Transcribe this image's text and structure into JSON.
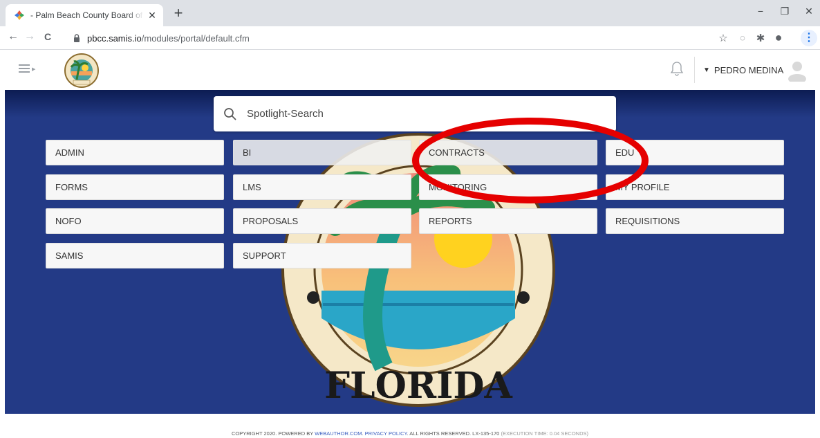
{
  "browser": {
    "tab_title": "- Palm Beach County Board of Co",
    "url_host": "pbcc.samis.io",
    "url_path": "/modules/portal/default.cfm",
    "window_min": "−",
    "window_restore": "❐",
    "window_close": "✕",
    "new_tab": "+",
    "tab_close": "✕",
    "back": "←",
    "forward": "→",
    "reload": "C"
  },
  "header": {
    "user_name": "PEDRO MEDINA",
    "user_chevron": "▼"
  },
  "search": {
    "placeholder": "Spotlight-Search"
  },
  "modules": [
    {
      "label": "ADMIN"
    },
    {
      "label": "BI"
    },
    {
      "label": "CONTRACTS"
    },
    {
      "label": "EDU"
    },
    {
      "label": "FORMS"
    },
    {
      "label": "LMS"
    },
    {
      "label": "MONITORING"
    },
    {
      "label": "MY PROFILE"
    },
    {
      "label": "NOFO"
    },
    {
      "label": "PROPOSALS"
    },
    {
      "label": "REPORTS"
    },
    {
      "label": "REQUISITIONS"
    },
    {
      "label": "SAMIS"
    },
    {
      "label": "SUPPORT"
    }
  ],
  "footer": {
    "prefix": "COPYRIGHT 2020. POWERED BY ",
    "powered_by_link": "WEBAUTHOR.COM",
    "separator": ". ",
    "privacy_link": "PRIVACY POLICY",
    "rights": ". ALL RIGHTS RESERVED. LX-135-170 ",
    "execution": "(EXECUTION TIME: 0.04 SECONDS)"
  },
  "seal": {
    "text_bottom": "FLORIDA"
  },
  "colors": {
    "main_bg": "#233a86",
    "highlight": "#e50000",
    "link": "#3b5fc0"
  }
}
